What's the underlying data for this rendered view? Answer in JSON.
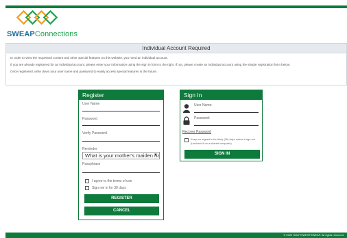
{
  "brand": {
    "name_part1": "SWEAP",
    "name_part2": "Connections"
  },
  "panel": {
    "title": "Individual Account Required",
    "line1": "In order to view the requested content and other special features on this website, you need an individual account.",
    "line2": "If you are already registered for an individual account, please enter your information using the sign in form to the right. If not, please create an individual account using the simple registration form below.",
    "line3": "Once registered, write down your user name and password to easily access special features in the future."
  },
  "register": {
    "title": "Register",
    "user_name_label": "User Name",
    "password_label": "Password",
    "verify_password_label": "Verify Password",
    "reminder_label": "Reminder",
    "reminder_value": "What is your mother's maiden name?",
    "passphrase_label": "Passphrase",
    "agree_terms_label": "I agree to the terms of use",
    "signin_30_label": "Sign me in for 30 days",
    "register_button": "REGISTER",
    "cancel_button": "CANCEL"
  },
  "signin": {
    "title": "Sign In",
    "user_name_label": "User Name:",
    "password_label": "Password:",
    "recover_link": "Recover Password",
    "keep_signed_in_label": "Keep me signed in for thirty (30) days unless I sign out. (Uncheck if on a shared computer)",
    "signin_button": "SIGN IN"
  },
  "footer": {
    "copyright": "© 2022 SOUTHWESTSWEAP. All rights reserved."
  },
  "colors": {
    "accent_green": "#0e7a3c",
    "brand_blue": "#1f6f9c",
    "brand_light_green": "#1aa14a",
    "logo_orange": "#f29a1d"
  }
}
